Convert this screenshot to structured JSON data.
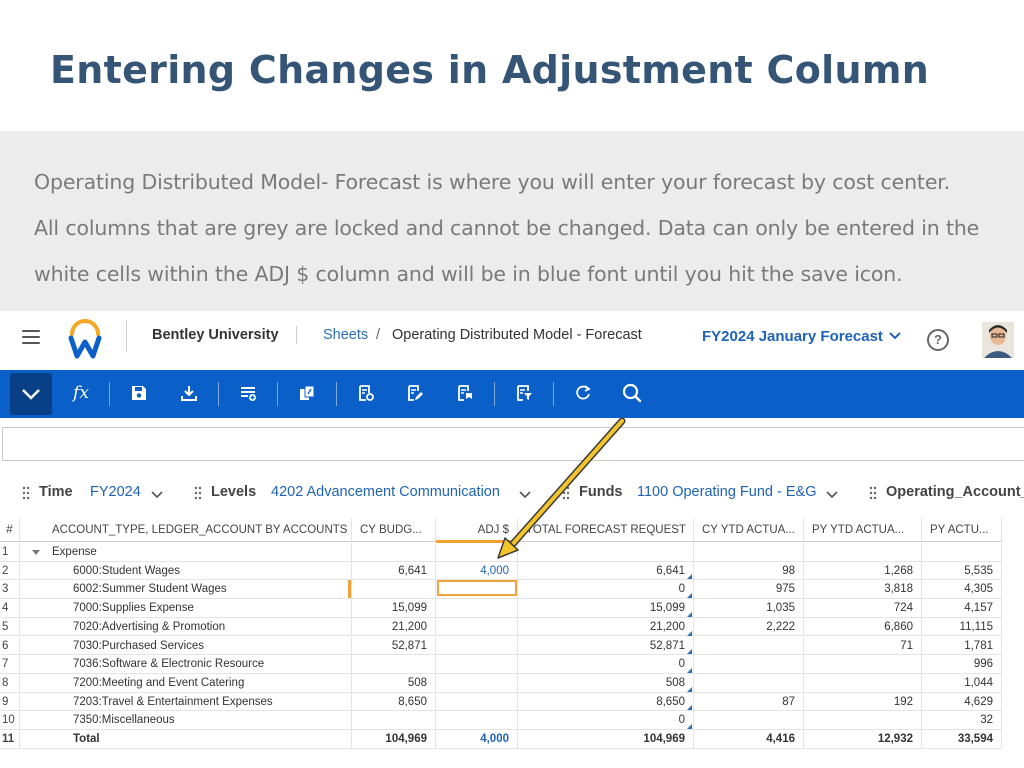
{
  "slide": {
    "title": "Entering Changes in Adjustment Column",
    "description": [
      "Operating Distributed Model- Forecast is where you will enter your forecast by cost center.",
      "All columns that are grey are locked and cannot be changed. Data can only be entered in the",
      "white cells within the ADJ $ column and will be in blue font until you hit the save icon."
    ]
  },
  "app": {
    "tenant": "Bentley University",
    "breadcrumb": {
      "sheets": "Sheets",
      "separator": "/",
      "page": "Operating Distributed Model - Forecast"
    },
    "scenario": "FY2024 January Forecast",
    "help_icon_label": "?",
    "accent_color": "#0a5fc8",
    "toolbar": {
      "fx_label": "fx",
      "icons": [
        "chevron-down-icon",
        "fx-icon",
        "save-icon",
        "download-icon",
        "insert-row-icon",
        "function-icon",
        "settings-sheet-icon",
        "edit-sheet-icon",
        "sheet-flag-icon",
        "filter-sheet-icon",
        "refresh-icon",
        "search-icon"
      ]
    },
    "filters": [
      {
        "name": "Time",
        "value": "FY2024"
      },
      {
        "name": "Levels",
        "value": "4202 Advancement Communication"
      },
      {
        "name": "Funds",
        "value": "1100 Operating Fund - E&G"
      },
      {
        "name": "Operating_Account_L",
        "value": ""
      }
    ],
    "grid": {
      "row_num_header": "#",
      "columns": [
        "ACCOUNT_TYPE, LEDGER_ACCOUNT BY ACCOUNTS",
        "CY BUDG...",
        "ADJ $",
        "TOTAL FORECAST REQUEST",
        "CY YTD ACTUA...",
        "PY YTD ACTUA...",
        "PY ACTU..."
      ],
      "rows": [
        {
          "num": "1",
          "account": "Expense",
          "group": true,
          "cy_budget": "",
          "adj": "",
          "total": "",
          "cy_ytd": "",
          "py_ytd": "",
          "py_act": ""
        },
        {
          "num": "2",
          "account": "6000:Student Wages",
          "cy_budget": "6,641",
          "adj": "4,000",
          "total": "6,641",
          "cy_ytd": "98",
          "py_ytd": "1,268",
          "py_act": "5,535"
        },
        {
          "num": "3",
          "account": "6002:Summer Student Wages",
          "cy_budget": "",
          "adj": "",
          "total": "0",
          "cy_ytd": "975",
          "py_ytd": "3,818",
          "py_act": "4,305"
        },
        {
          "num": "4",
          "account": "7000:Supplies Expense",
          "cy_budget": "15,099",
          "adj": "",
          "total": "15,099",
          "cy_ytd": "1,035",
          "py_ytd": "724",
          "py_act": "4,157"
        },
        {
          "num": "5",
          "account": "7020:Advertising & Promotion",
          "cy_budget": "21,200",
          "adj": "",
          "total": "21,200",
          "cy_ytd": "2,222",
          "py_ytd": "6,860",
          "py_act": "11,115"
        },
        {
          "num": "6",
          "account": "7030:Purchased Services",
          "cy_budget": "52,871",
          "adj": "",
          "total": "52,871",
          "cy_ytd": "",
          "py_ytd": "71",
          "py_act": "1,781"
        },
        {
          "num": "7",
          "account": "7036:Software & Electronic Resource",
          "cy_budget": "",
          "adj": "",
          "total": "0",
          "cy_ytd": "",
          "py_ytd": "",
          "py_act": "996"
        },
        {
          "num": "8",
          "account": "7200:Meeting and Event Catering",
          "cy_budget": "508",
          "adj": "",
          "total": "508",
          "cy_ytd": "",
          "py_ytd": "",
          "py_act": "1,044"
        },
        {
          "num": "9",
          "account": "7203:Travel & Entertainment Expenses",
          "cy_budget": "8,650",
          "adj": "",
          "total": "8,650",
          "cy_ytd": "87",
          "py_ytd": "192",
          "py_act": "4,629"
        },
        {
          "num": "10",
          "account": "7350:Miscellaneous",
          "cy_budget": "",
          "adj": "",
          "total": "0",
          "cy_ytd": "",
          "py_ytd": "",
          "py_act": "32"
        },
        {
          "num": "11",
          "account": "Total",
          "total_row": true,
          "cy_budget": "104,969",
          "adj": "4,000",
          "total": "104,969",
          "cy_ytd": "4,416",
          "py_ytd": "12,932",
          "py_act": "33,594"
        }
      ]
    }
  }
}
